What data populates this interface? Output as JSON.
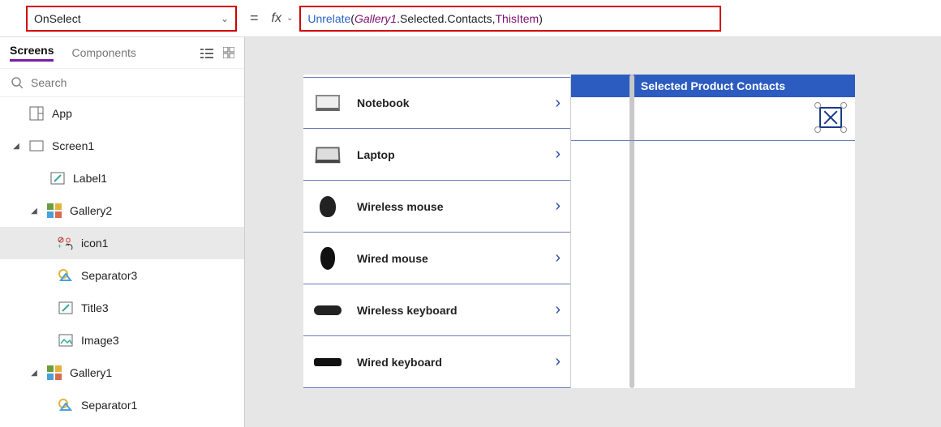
{
  "formula_bar": {
    "property": "OnSelect",
    "fx_label": "fx",
    "parts": {
      "fn": "Unrelate",
      "open": "( ",
      "obj": "Gallery1",
      "mid": ".Selected.Contacts, ",
      "kw": "ThisItem",
      "close": " )"
    }
  },
  "tabs": {
    "screens": "Screens",
    "components": "Components"
  },
  "search": {
    "placeholder": "Search"
  },
  "tree": {
    "app": "App",
    "screen1": "Screen1",
    "label1": "Label1",
    "gallery2": "Gallery2",
    "icon1": "icon1",
    "separator3": "Separator3",
    "title3": "Title3",
    "image3": "Image3",
    "gallery1": "Gallery1",
    "separator1": "Separator1"
  },
  "preview": {
    "header": "Selected Product Contacts",
    "products": [
      {
        "name": "Notebook"
      },
      {
        "name": "Laptop"
      },
      {
        "name": "Wireless mouse"
      },
      {
        "name": "Wired mouse"
      },
      {
        "name": "Wireless keyboard"
      },
      {
        "name": "Wired keyboard"
      }
    ]
  }
}
